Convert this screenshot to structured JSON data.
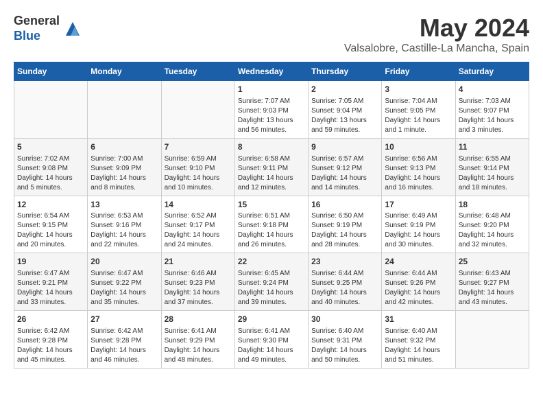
{
  "logo": {
    "general": "General",
    "blue": "Blue"
  },
  "title": "May 2024",
  "location": "Valsalobre, Castille-La Mancha, Spain",
  "days_of_week": [
    "Sunday",
    "Monday",
    "Tuesday",
    "Wednesday",
    "Thursday",
    "Friday",
    "Saturday"
  ],
  "weeks": [
    [
      {
        "day": "",
        "info": ""
      },
      {
        "day": "",
        "info": ""
      },
      {
        "day": "",
        "info": ""
      },
      {
        "day": "1",
        "info": "Sunrise: 7:07 AM\nSunset: 9:03 PM\nDaylight: 13 hours and 56 minutes."
      },
      {
        "day": "2",
        "info": "Sunrise: 7:05 AM\nSunset: 9:04 PM\nDaylight: 13 hours and 59 minutes."
      },
      {
        "day": "3",
        "info": "Sunrise: 7:04 AM\nSunset: 9:05 PM\nDaylight: 14 hours and 1 minute."
      },
      {
        "day": "4",
        "info": "Sunrise: 7:03 AM\nSunset: 9:07 PM\nDaylight: 14 hours and 3 minutes."
      }
    ],
    [
      {
        "day": "5",
        "info": "Sunrise: 7:02 AM\nSunset: 9:08 PM\nDaylight: 14 hours and 5 minutes."
      },
      {
        "day": "6",
        "info": "Sunrise: 7:00 AM\nSunset: 9:09 PM\nDaylight: 14 hours and 8 minutes."
      },
      {
        "day": "7",
        "info": "Sunrise: 6:59 AM\nSunset: 9:10 PM\nDaylight: 14 hours and 10 minutes."
      },
      {
        "day": "8",
        "info": "Sunrise: 6:58 AM\nSunset: 9:11 PM\nDaylight: 14 hours and 12 minutes."
      },
      {
        "day": "9",
        "info": "Sunrise: 6:57 AM\nSunset: 9:12 PM\nDaylight: 14 hours and 14 minutes."
      },
      {
        "day": "10",
        "info": "Sunrise: 6:56 AM\nSunset: 9:13 PM\nDaylight: 14 hours and 16 minutes."
      },
      {
        "day": "11",
        "info": "Sunrise: 6:55 AM\nSunset: 9:14 PM\nDaylight: 14 hours and 18 minutes."
      }
    ],
    [
      {
        "day": "12",
        "info": "Sunrise: 6:54 AM\nSunset: 9:15 PM\nDaylight: 14 hours and 20 minutes."
      },
      {
        "day": "13",
        "info": "Sunrise: 6:53 AM\nSunset: 9:16 PM\nDaylight: 14 hours and 22 minutes."
      },
      {
        "day": "14",
        "info": "Sunrise: 6:52 AM\nSunset: 9:17 PM\nDaylight: 14 hours and 24 minutes."
      },
      {
        "day": "15",
        "info": "Sunrise: 6:51 AM\nSunset: 9:18 PM\nDaylight: 14 hours and 26 minutes."
      },
      {
        "day": "16",
        "info": "Sunrise: 6:50 AM\nSunset: 9:19 PM\nDaylight: 14 hours and 28 minutes."
      },
      {
        "day": "17",
        "info": "Sunrise: 6:49 AM\nSunset: 9:19 PM\nDaylight: 14 hours and 30 minutes."
      },
      {
        "day": "18",
        "info": "Sunrise: 6:48 AM\nSunset: 9:20 PM\nDaylight: 14 hours and 32 minutes."
      }
    ],
    [
      {
        "day": "19",
        "info": "Sunrise: 6:47 AM\nSunset: 9:21 PM\nDaylight: 14 hours and 33 minutes."
      },
      {
        "day": "20",
        "info": "Sunrise: 6:47 AM\nSunset: 9:22 PM\nDaylight: 14 hours and 35 minutes."
      },
      {
        "day": "21",
        "info": "Sunrise: 6:46 AM\nSunset: 9:23 PM\nDaylight: 14 hours and 37 minutes."
      },
      {
        "day": "22",
        "info": "Sunrise: 6:45 AM\nSunset: 9:24 PM\nDaylight: 14 hours and 39 minutes."
      },
      {
        "day": "23",
        "info": "Sunrise: 6:44 AM\nSunset: 9:25 PM\nDaylight: 14 hours and 40 minutes."
      },
      {
        "day": "24",
        "info": "Sunrise: 6:44 AM\nSunset: 9:26 PM\nDaylight: 14 hours and 42 minutes."
      },
      {
        "day": "25",
        "info": "Sunrise: 6:43 AM\nSunset: 9:27 PM\nDaylight: 14 hours and 43 minutes."
      }
    ],
    [
      {
        "day": "26",
        "info": "Sunrise: 6:42 AM\nSunset: 9:28 PM\nDaylight: 14 hours and 45 minutes."
      },
      {
        "day": "27",
        "info": "Sunrise: 6:42 AM\nSunset: 9:28 PM\nDaylight: 14 hours and 46 minutes."
      },
      {
        "day": "28",
        "info": "Sunrise: 6:41 AM\nSunset: 9:29 PM\nDaylight: 14 hours and 48 minutes."
      },
      {
        "day": "29",
        "info": "Sunrise: 6:41 AM\nSunset: 9:30 PM\nDaylight: 14 hours and 49 minutes."
      },
      {
        "day": "30",
        "info": "Sunrise: 6:40 AM\nSunset: 9:31 PM\nDaylight: 14 hours and 50 minutes."
      },
      {
        "day": "31",
        "info": "Sunrise: 6:40 AM\nSunset: 9:32 PM\nDaylight: 14 hours and 51 minutes."
      },
      {
        "day": "",
        "info": ""
      }
    ]
  ]
}
